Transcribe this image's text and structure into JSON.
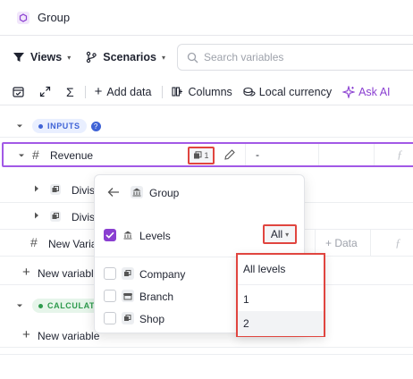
{
  "title": "Group",
  "toolbar": {
    "views_label": "Views",
    "scenarios_label": "Scenarios",
    "search_placeholder": "Search variables"
  },
  "actions": {
    "add_data": "Add data",
    "columns": "Columns",
    "local_currency": "Local currency",
    "ask_ai": "Ask AI"
  },
  "sections": {
    "inputs": "INPUTS",
    "calculations": "CALCULAT"
  },
  "rows": {
    "revenue": "Revenue",
    "revenue_value": "-",
    "revenue_count": "1",
    "division_1": "Divisi",
    "division_2": "Divisi",
    "new_variable_row": "New Varia",
    "add_data_cell": "Data",
    "new_variable_1": "New variabl",
    "new_variable_2": "New variable"
  },
  "popover": {
    "title": "Group",
    "levels_label": "Levels",
    "levels_value": "All",
    "options": [
      "Company",
      "Branch",
      "Shop"
    ]
  },
  "dropdown": {
    "options": [
      "All levels",
      "1",
      "2"
    ]
  },
  "colors": {
    "accent_purple": "#8a3fd1",
    "highlight_red": "#e0453f",
    "inputs_badge": "#3f63d6",
    "calculations_badge": "#2d9a4c"
  }
}
